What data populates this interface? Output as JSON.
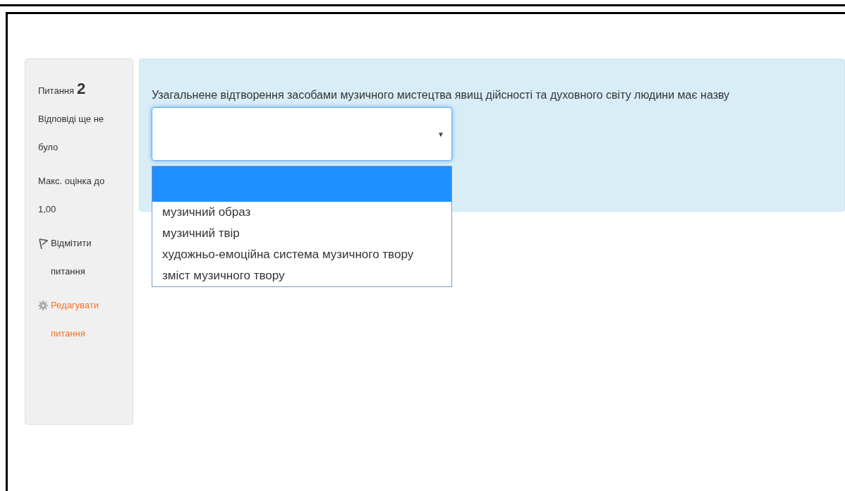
{
  "info": {
    "question_label": "Питання",
    "question_number": "2",
    "state": "Відповіді ще не було",
    "grade": "Макс. оцінка до 1,00",
    "flag_link": "Відмітити питання",
    "edit_link": "Редагувати питання"
  },
  "question": {
    "text": "Узагальнене відтворення засобами музичного мистецтва явищ дійсності та духовного світу людини має назву",
    "select": {
      "arrow": "▼",
      "expanded": true,
      "options": [
        {
          "selected": true
        },
        {
          "label": "музичний образ",
          "selected": false
        },
        {
          "label": "музичний твір",
          "selected": false
        },
        {
          "label": "художньо-емоційна система музичного твору",
          "selected": false
        },
        {
          "label": "зміст музичного твору",
          "selected": false
        }
      ]
    }
  }
}
